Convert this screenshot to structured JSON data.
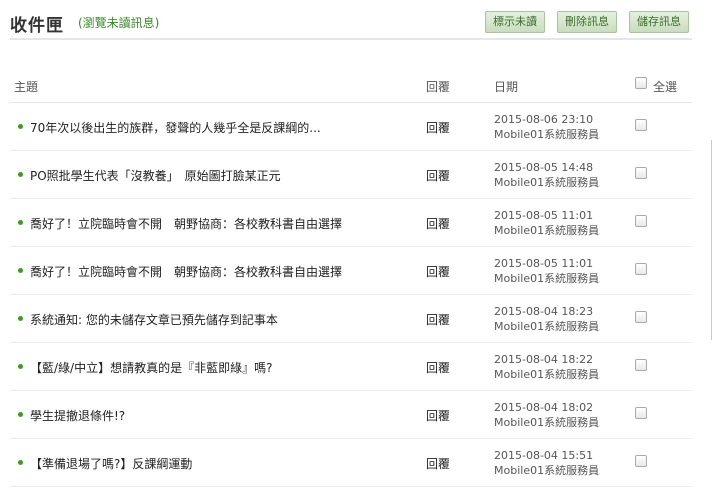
{
  "header": {
    "title": "收件匣",
    "subtitle": "(瀏覽未讀訊息)",
    "btn_mark_unread": "標示未讀",
    "btn_delete": "刪除訊息",
    "btn_save": "儲存訊息"
  },
  "table": {
    "col_subject": "主題",
    "col_reply": "回覆",
    "col_date": "日期",
    "col_select_all": "全選",
    "rows": [
      {
        "subject": "70年次以後出生的族群，發聲的人幾乎全是反課綱的...",
        "reply": "回覆",
        "date": "2015-08-06 23:10",
        "sender": "Mobile01系統服務員"
      },
      {
        "subject": "PO照批學生代表「沒教養」　原始圖打臉某正元",
        "reply": "回覆",
        "date": "2015-08-05 14:48",
        "sender": "Mobile01系統服務員"
      },
      {
        "subject": "喬好了！立院臨時會不開　朝野協商：各校教科書自由選擇",
        "reply": "回覆",
        "date": "2015-08-05 11:01",
        "sender": "Mobile01系統服務員"
      },
      {
        "subject": "喬好了！立院臨時會不開　朝野協商：各校教科書自由選擇",
        "reply": "回覆",
        "date": "2015-08-05 11:01",
        "sender": "Mobile01系統服務員"
      },
      {
        "subject": "系統通知: 您的未儲存文章已預先儲存到記事本",
        "reply": "回覆",
        "date": "2015-08-04 18:23",
        "sender": "Mobile01系統服務員"
      },
      {
        "subject": "【藍/綠/中立】想請教真的是『非藍即綠』嗎?",
        "reply": "回覆",
        "date": "2015-08-04 18:22",
        "sender": "Mobile01系統服務員"
      },
      {
        "subject": "學生提撤退條件!?",
        "reply": "回覆",
        "date": "2015-08-04 18:02",
        "sender": "Mobile01系統服務員"
      },
      {
        "subject": "【準備退場了嗎?】反課綱運動",
        "reply": "回覆",
        "date": "2015-08-04 15:51",
        "sender": "Mobile01系統服務員"
      }
    ]
  },
  "colors": {
    "accent_green": "#3a9a2a",
    "button_bg": "#d6e6cd"
  }
}
